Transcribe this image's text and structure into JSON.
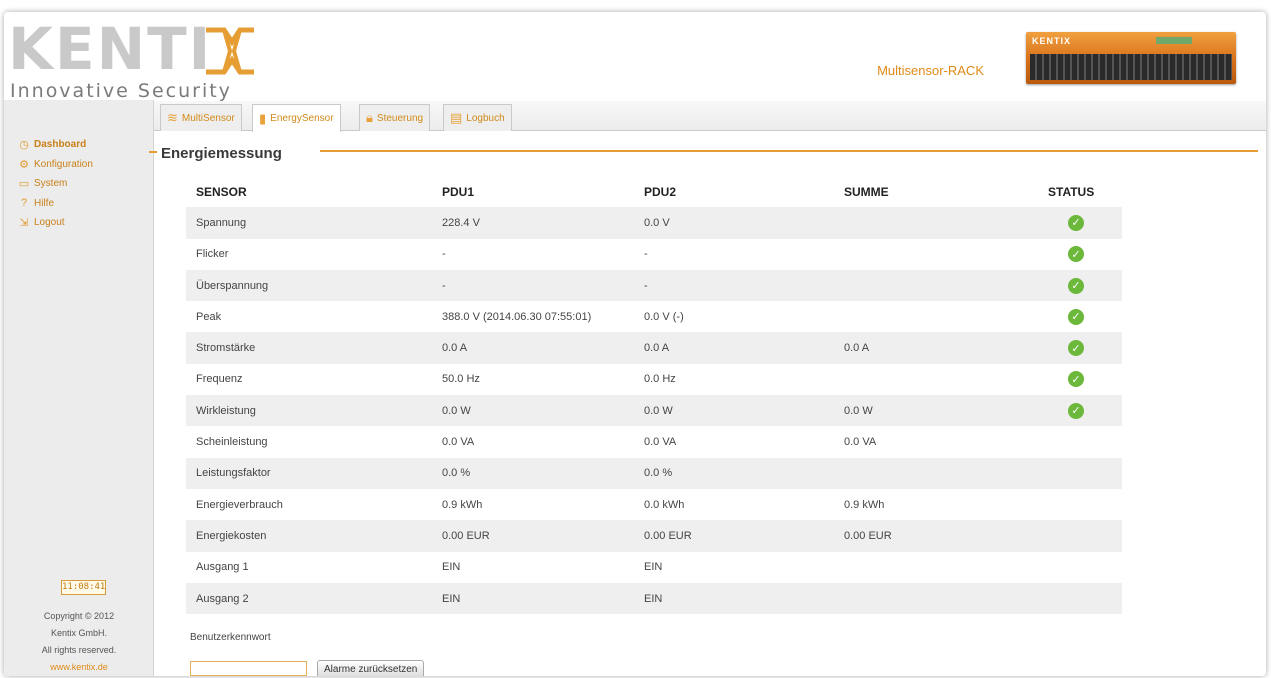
{
  "brand": {
    "logo_word": "KENTI",
    "tagline": "Innovative Security",
    "product_name": "Multisensor-RACK",
    "device_label": "KENTIX"
  },
  "tabs": [
    {
      "label": "MultiSensor",
      "icon": "sensor-icon",
      "active": false
    },
    {
      "label": "EnergySensor",
      "icon": "plug-icon",
      "active": true
    },
    {
      "label": "Steuerung",
      "icon": "lock-icon",
      "active": false
    },
    {
      "label": "Logbuch",
      "icon": "logbook-icon",
      "active": false
    }
  ],
  "sidebar": {
    "items": [
      {
        "label": "Dashboard",
        "icon": "clock-icon"
      },
      {
        "label": "Konfiguration",
        "icon": "wrench-icon"
      },
      {
        "label": "System",
        "icon": "monitor-icon"
      },
      {
        "label": "Hilfe",
        "icon": "help-icon"
      },
      {
        "label": "Logout",
        "icon": "logout-icon"
      }
    ],
    "clock": "11:08:41",
    "copyright": "Copyright © 2012",
    "company": "Kentix GmbH.",
    "rights": "All rights reserved.",
    "website": "www.kentix.de"
  },
  "section": {
    "title": "Energiemessung"
  },
  "table": {
    "headers": [
      "SENSOR",
      "PDU1",
      "PDU2",
      "SUMME",
      "STATUS"
    ],
    "rows": [
      {
        "sensor": "Spannung",
        "pdu1": "228.4 V",
        "pdu2": "0.0 V",
        "summe": "",
        "status": "ok"
      },
      {
        "sensor": "Flicker",
        "pdu1": "-",
        "pdu2": "-",
        "summe": "",
        "status": "ok"
      },
      {
        "sensor": "Überspannung",
        "pdu1": "-",
        "pdu2": "-",
        "summe": "",
        "status": "ok"
      },
      {
        "sensor": "Peak",
        "pdu1": "388.0 V (2014.06.30 07:55:01)",
        "pdu2": "0.0 V (-)",
        "summe": "",
        "status": "ok"
      },
      {
        "sensor": "Stromstärke",
        "pdu1": "0.0 A",
        "pdu2": "0.0 A",
        "summe": "0.0 A",
        "status": "ok"
      },
      {
        "sensor": "Frequenz",
        "pdu1": "50.0 Hz",
        "pdu2": "0.0 Hz",
        "summe": "",
        "status": "ok"
      },
      {
        "sensor": "Wirkleistung",
        "pdu1": "0.0 W",
        "pdu2": "0.0 W",
        "summe": "0.0 W",
        "status": "ok"
      },
      {
        "sensor": "Scheinleistung",
        "pdu1": "0.0 VA",
        "pdu2": "0.0 VA",
        "summe": "0.0 VA",
        "status": ""
      },
      {
        "sensor": "Leistungsfaktor",
        "pdu1": "0.0 %",
        "pdu2": "0.0 %",
        "summe": "",
        "status": ""
      },
      {
        "sensor": "Energieverbrauch",
        "pdu1": "0.9 kWh",
        "pdu2": "0.0 kWh",
        "summe": "0.9 kWh",
        "status": ""
      },
      {
        "sensor": "Energiekosten",
        "pdu1": "0.00 EUR",
        "pdu2": "0.00 EUR",
        "summe": "0.00 EUR",
        "status": ""
      },
      {
        "sensor": "Ausgang 1",
        "pdu1": "EIN",
        "pdu2": "EIN",
        "summe": "",
        "status": ""
      },
      {
        "sensor": "Ausgang 2",
        "pdu1": "EIN",
        "pdu2": "EIN",
        "summe": "",
        "status": ""
      }
    ]
  },
  "password": {
    "label": "Benutzerkennwort",
    "value": "",
    "placeholder": ""
  },
  "reset_button": {
    "label": "Alarme zurücksetzen"
  },
  "colors": {
    "accent": "#e59d34",
    "status_ok": "#6bb83a",
    "row_alt": "#efefef"
  }
}
